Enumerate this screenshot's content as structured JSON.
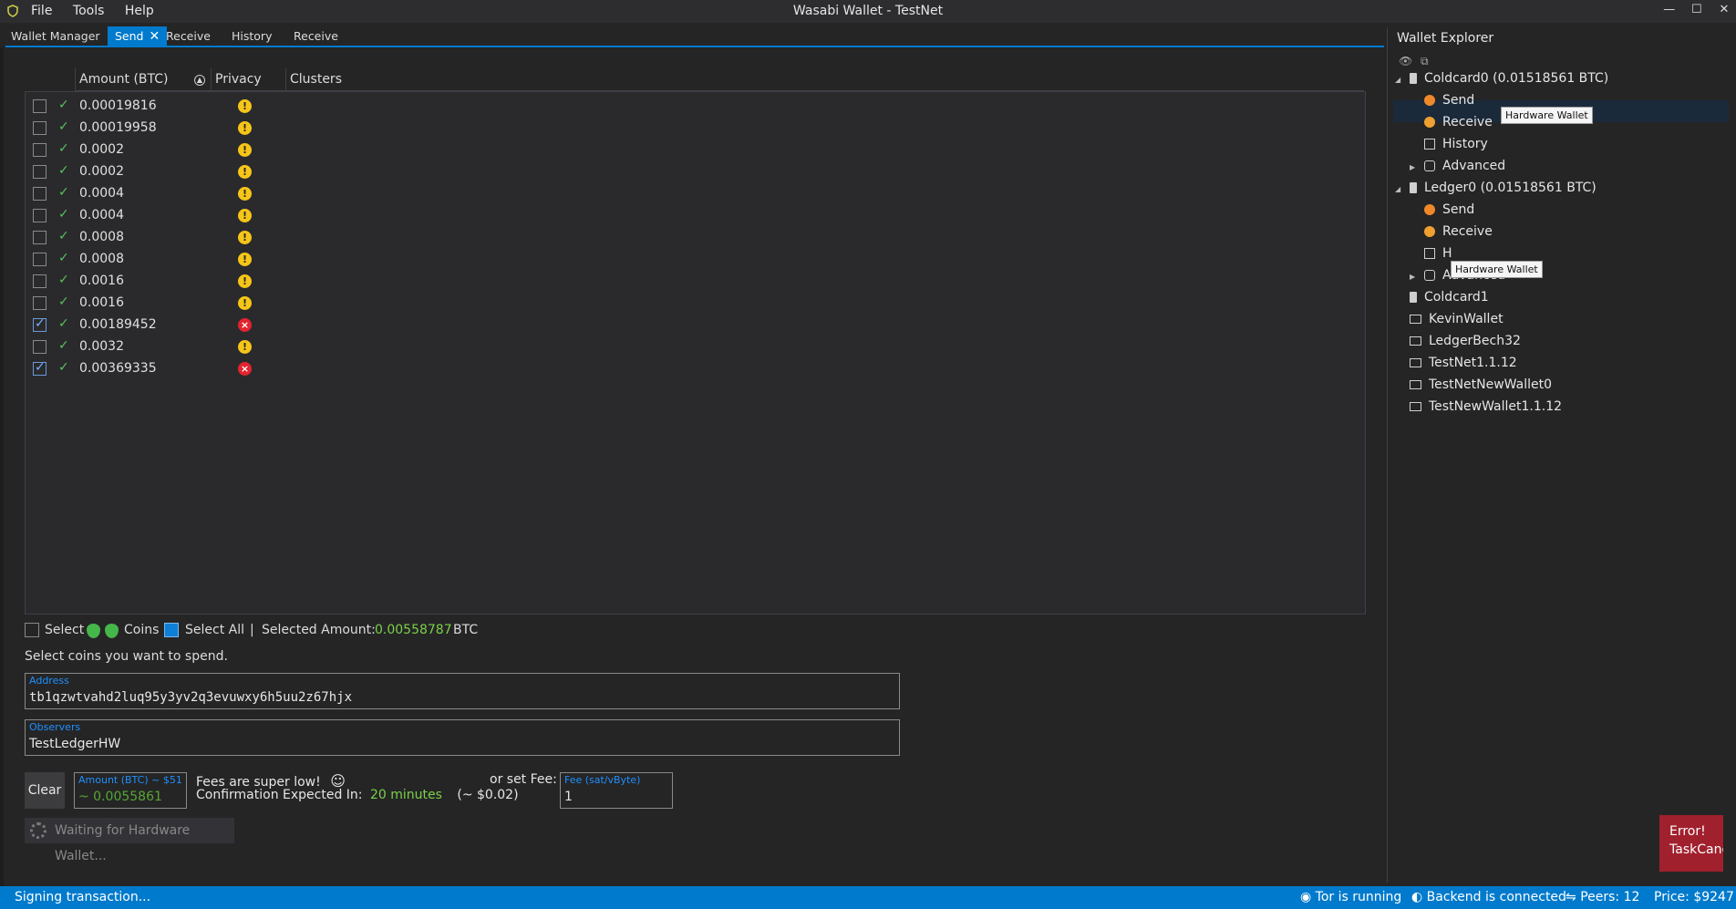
{
  "window": {
    "title": "Wasabi Wallet - TestNet",
    "menu": [
      "File",
      "Tools",
      "Help"
    ],
    "controls": [
      "—",
      "☐",
      "✕"
    ]
  },
  "tabs": [
    {
      "label": "Wallet Manager"
    },
    {
      "label": "Send",
      "active": true,
      "close": "✕"
    },
    {
      "label": "Receive"
    },
    {
      "label": "History"
    },
    {
      "label": "Receive"
    }
  ],
  "grid": {
    "headers": [
      "Amount (BTC)",
      "Privacy",
      "Clusters"
    ],
    "rows": [
      {
        "amount": "0.00019816",
        "checked": false,
        "privacy": "warn"
      },
      {
        "amount": "0.00019958",
        "checked": false,
        "privacy": "warn"
      },
      {
        "amount": "0.0002",
        "checked": false,
        "privacy": "warn"
      },
      {
        "amount": "0.0002",
        "checked": false,
        "privacy": "warn"
      },
      {
        "amount": "0.0004",
        "checked": false,
        "privacy": "warn"
      },
      {
        "amount": "0.0004",
        "checked": false,
        "privacy": "warn"
      },
      {
        "amount": "0.0008",
        "checked": false,
        "privacy": "warn"
      },
      {
        "amount": "0.0008",
        "checked": false,
        "privacy": "warn"
      },
      {
        "amount": "0.0016",
        "checked": false,
        "privacy": "warn"
      },
      {
        "amount": "0.0016",
        "checked": false,
        "privacy": "warn"
      },
      {
        "amount": "0.00189452",
        "checked": true,
        "privacy": "bad"
      },
      {
        "amount": "0.0032",
        "checked": false,
        "privacy": "warn"
      },
      {
        "amount": "0.00369335",
        "checked": true,
        "privacy": "bad"
      }
    ]
  },
  "selection": {
    "select_label": "Select",
    "coins_label": "Coins",
    "select_all_label": "Select All",
    "separator": "|",
    "selected_amount_label": "Selected Amount:",
    "selected_amount": "0.00558787",
    "unit": "BTC",
    "hint": "Select coins you want to spend."
  },
  "address": {
    "label": "Address",
    "value": "tb1qzwtvahd2luq95y3yv2q3evuwxy6h5uu2z67hjx"
  },
  "observers": {
    "label": "Observers",
    "value": "TestLedgerHW"
  },
  "send_form": {
    "clear_label": "Clear",
    "amount_label": "Amount (BTC) ~ $51",
    "amount_value": "~ 0.0055861",
    "fees_text": "Fees are super low!",
    "smiley": "☺",
    "confirmation_label": "Confirmation Expected In:",
    "confirmation_value": "20 minutes",
    "fee_usd": "(~ $0.02)",
    "or_set_fee": "or set Fee:",
    "fee_label": "Fee (sat/vByte)",
    "fee_value": "1",
    "waiting_label": "Waiting for Hardware Wallet..."
  },
  "explorer": {
    "title": "Wallet Explorer",
    "tools": [
      "👁",
      "⧉"
    ],
    "items": [
      {
        "label": "Coldcard0 (0.01518561 BTC)",
        "level": 0,
        "icon": "hardware-wallet-icon",
        "expanded": true
      },
      {
        "label": "Send",
        "level": 1,
        "icon": "send-icon"
      },
      {
        "label": "Receive",
        "level": 1,
        "icon": "receive-icon"
      },
      {
        "label": "History",
        "level": 1,
        "icon": "history-icon"
      },
      {
        "label": "Advanced",
        "level": 1,
        "icon": "advanced-icon",
        "expandable": true
      },
      {
        "label": "Ledger0 (0.01518561 BTC)",
        "level": 0,
        "icon": "hardware-wallet-icon",
        "expanded": true
      },
      {
        "label": "Send",
        "level": 1,
        "icon": "send-icon"
      },
      {
        "label": "Receive",
        "level": 1,
        "icon": "receive-icon"
      },
      {
        "label": "H",
        "level": 1,
        "icon": "history-icon"
      },
      {
        "label": "Advanced",
        "level": 1,
        "icon": "advanced-icon",
        "expandable": true
      },
      {
        "label": "Coldcard1",
        "level": 0,
        "icon": "hardware-wallet-icon"
      },
      {
        "label": "KevinWallet",
        "level": 0,
        "icon": "wallet-icon"
      },
      {
        "label": "LedgerBech32",
        "level": 0,
        "icon": "wallet-icon"
      },
      {
        "label": "TestNet1.1.12",
        "level": 0,
        "icon": "wallet-icon"
      },
      {
        "label": "TestNetNewWallet0",
        "level": 0,
        "icon": "wallet-icon"
      },
      {
        "label": "TestNewWallet1.1.12",
        "level": 0,
        "icon": "wallet-icon"
      }
    ],
    "tooltips": [
      "Hardware Wallet",
      "Hardware Wallet"
    ]
  },
  "error_toast": {
    "line1": "Error!",
    "line2": "TaskCanc"
  },
  "status": {
    "left": "Signing transaction...",
    "tor": "Tor is running",
    "backend": "Backend is connected",
    "peers": "Peers: 12",
    "price": "Price: $9247"
  },
  "colors": {
    "accent": "#007acc",
    "green": "#7bd149",
    "warning": "#f5c518",
    "danger": "#e2242f"
  }
}
